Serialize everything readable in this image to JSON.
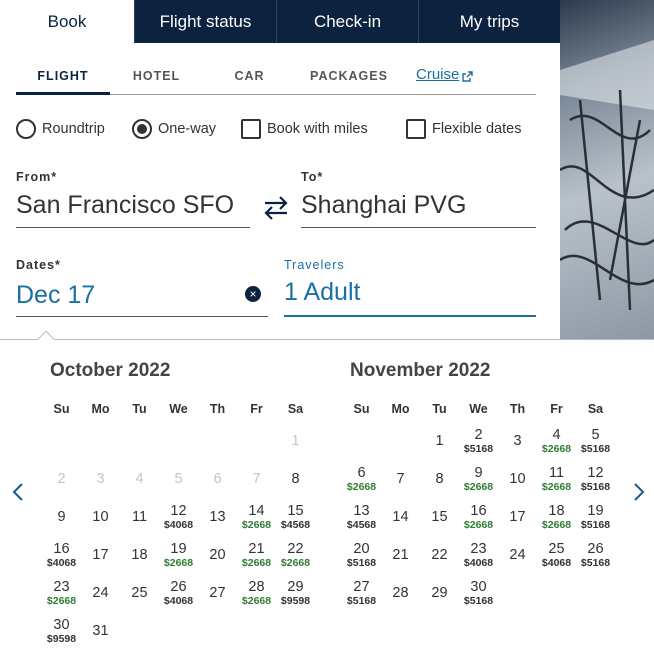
{
  "tabs": [
    {
      "label": "Book",
      "active": true
    },
    {
      "label": "Flight status",
      "active": false
    },
    {
      "label": "Check-in",
      "active": false
    },
    {
      "label": "My trips",
      "active": false
    }
  ],
  "subtabs": {
    "flight": "FLIGHT",
    "hotel": "HOTEL",
    "car": "CAR",
    "packages": "PACKAGES",
    "cruise": "Cruise"
  },
  "options": {
    "roundtrip": "Roundtrip",
    "oneway": "One-way",
    "miles": "Book with miles",
    "flexible": "Flexible dates",
    "selected_trip": "One-way"
  },
  "from": {
    "label": "From*",
    "value": "San Francisco SFO"
  },
  "to": {
    "label": "To*",
    "value": "Shanghai PVG"
  },
  "dates": {
    "label": "Dates*",
    "value": "Dec 17"
  },
  "travelers": {
    "label": "Travelers",
    "value": "1 Adult"
  },
  "colors": {
    "navy": "#0c2340",
    "blue": "#1a6fa3",
    "green_price": "#2f7d32"
  },
  "icons": {
    "swap": "swap-arrows-icon",
    "clear": "clear-x-icon",
    "external": "external-link-icon",
    "prev": "chevron-left-icon",
    "next": "chevron-right-icon"
  },
  "weekdays": [
    "Su",
    "Mo",
    "Tu",
    "We",
    "Th",
    "Fr",
    "Sa"
  ],
  "months": [
    {
      "title": "October 2022",
      "weeks": [
        [
          null,
          null,
          null,
          null,
          null,
          null,
          {
            "d": "1",
            "disabled": true
          }
        ],
        [
          {
            "d": "2",
            "disabled": true
          },
          {
            "d": "3",
            "disabled": true
          },
          {
            "d": "4",
            "disabled": true
          },
          {
            "d": "5",
            "disabled": true
          },
          {
            "d": "6",
            "disabled": true
          },
          {
            "d": "7",
            "disabled": true
          },
          {
            "d": "8"
          }
        ],
        [
          {
            "d": "9"
          },
          {
            "d": "10"
          },
          {
            "d": "11"
          },
          {
            "d": "12",
            "p": "$4068"
          },
          {
            "d": "13"
          },
          {
            "d": "14",
            "p": "$2668",
            "g": true
          },
          {
            "d": "15",
            "p": "$4568"
          }
        ],
        [
          {
            "d": "16",
            "p": "$4068"
          },
          {
            "d": "17"
          },
          {
            "d": "18"
          },
          {
            "d": "19",
            "p": "$2668",
            "g": true
          },
          {
            "d": "20"
          },
          {
            "d": "21",
            "p": "$2668",
            "g": true
          },
          {
            "d": "22",
            "p": "$2668",
            "g": true
          }
        ],
        [
          {
            "d": "23",
            "p": "$2668",
            "g": true
          },
          {
            "d": "24"
          },
          {
            "d": "25"
          },
          {
            "d": "26",
            "p": "$4068"
          },
          {
            "d": "27"
          },
          {
            "d": "28",
            "p": "$2668",
            "g": true
          },
          {
            "d": "29",
            "p": "$9598"
          }
        ],
        [
          {
            "d": "30",
            "p": "$9598"
          },
          {
            "d": "31"
          },
          null,
          null,
          null,
          null,
          null
        ]
      ]
    },
    {
      "title": "November 2022",
      "weeks": [
        [
          null,
          null,
          {
            "d": "1"
          },
          {
            "d": "2",
            "p": "$5168"
          },
          {
            "d": "3"
          },
          {
            "d": "4",
            "p": "$2668",
            "g": true
          },
          {
            "d": "5",
            "p": "$5168"
          }
        ],
        [
          {
            "d": "6",
            "p": "$2668",
            "g": true
          },
          {
            "d": "7"
          },
          {
            "d": "8"
          },
          {
            "d": "9",
            "p": "$2668",
            "g": true
          },
          {
            "d": "10"
          },
          {
            "d": "11",
            "p": "$2668",
            "g": true
          },
          {
            "d": "12",
            "p": "$5168"
          }
        ],
        [
          {
            "d": "13",
            "p": "$4568"
          },
          {
            "d": "14"
          },
          {
            "d": "15"
          },
          {
            "d": "16",
            "p": "$2668",
            "g": true
          },
          {
            "d": "17"
          },
          {
            "d": "18",
            "p": "$2668",
            "g": true
          },
          {
            "d": "19",
            "p": "$5168"
          }
        ],
        [
          {
            "d": "20",
            "p": "$5168"
          },
          {
            "d": "21"
          },
          {
            "d": "22"
          },
          {
            "d": "23",
            "p": "$4068"
          },
          {
            "d": "24"
          },
          {
            "d": "25",
            "p": "$4068"
          },
          {
            "d": "26",
            "p": "$5168"
          }
        ],
        [
          {
            "d": "27",
            "p": "$5168"
          },
          {
            "d": "28"
          },
          {
            "d": "29"
          },
          {
            "d": "30",
            "p": "$5168"
          },
          null,
          null,
          null
        ]
      ]
    }
  ]
}
